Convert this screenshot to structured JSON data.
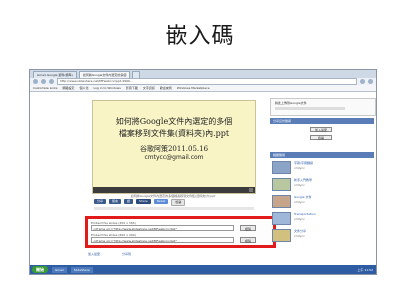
{
  "slide": {
    "title": "嵌入碼"
  },
  "browser": {
    "tabs": [
      {
        "label": "Gmail-Google 郵件(標準)",
        "active": false
      },
      {
        "label": "如何將Google文件內選定的多個",
        "active": true
      },
      {
        "label": "",
        "active": false
      }
    ],
    "address": "http://www.slideshare.net/MFwebcnc/ppt-4999...",
    "bookmarks": [
      "Customize Links",
      "網路設定",
      "個人化",
      "Log in to Windows",
      "影音下載",
      "文字資訊",
      "歡迎來到",
      "Windows Marketplace"
    ]
  },
  "presentation": {
    "line1": "如何將Google文件內選定的多個",
    "line2": "檔案移到文件集(資料夾)內.ppt",
    "line3": "谷歌阿策2011.05.16",
    "line4": "cmtycc@gmail.com",
    "caption": "如何將Google文件內選定的多個檔案移到文件集(資料夾)內.ppt"
  },
  "share_buttons": [
    "分享",
    "留言",
    "讚",
    "Share",
    "Tweet",
    "檢舉"
  ],
  "embed": {
    "label1": "Embed this slides (450 x 365)",
    "code1": "<iframe src=\"http://www.slideshare.net/MFwebcnc/ppt\"",
    "button1": "複製",
    "label2": "Embed this slides (600 x 490)",
    "code2": "<iframe src=\"http://www.slideshare.net/MFwebcnc/ppt\"",
    "button2": "複製"
  },
  "below": {
    "left": "加入最愛",
    "right": "分享到"
  },
  "right_panel": {
    "top_link": "將此上傳到Google文件",
    "section1": "分享這份簡報",
    "btn_a": "加入最愛",
    "btn_b": "檢舉",
    "section2": "相關簡報",
    "items": [
      {
        "title": "字幕/字幕翻譯",
        "sub": "cmtycc"
      },
      {
        "title": "新手入門教學",
        "sub": "cmtycc"
      },
      {
        "title": "Google 文件",
        "sub": "cmtycc"
      },
      {
        "title": "Transportation",
        "sub": "cmtycc"
      },
      {
        "title": "文件分享",
        "sub": "cmtycc"
      }
    ]
  },
  "taskbar": {
    "start": "開始",
    "items": [
      "Gmail",
      "SlideShare"
    ],
    "clock": "上午 11:52"
  }
}
